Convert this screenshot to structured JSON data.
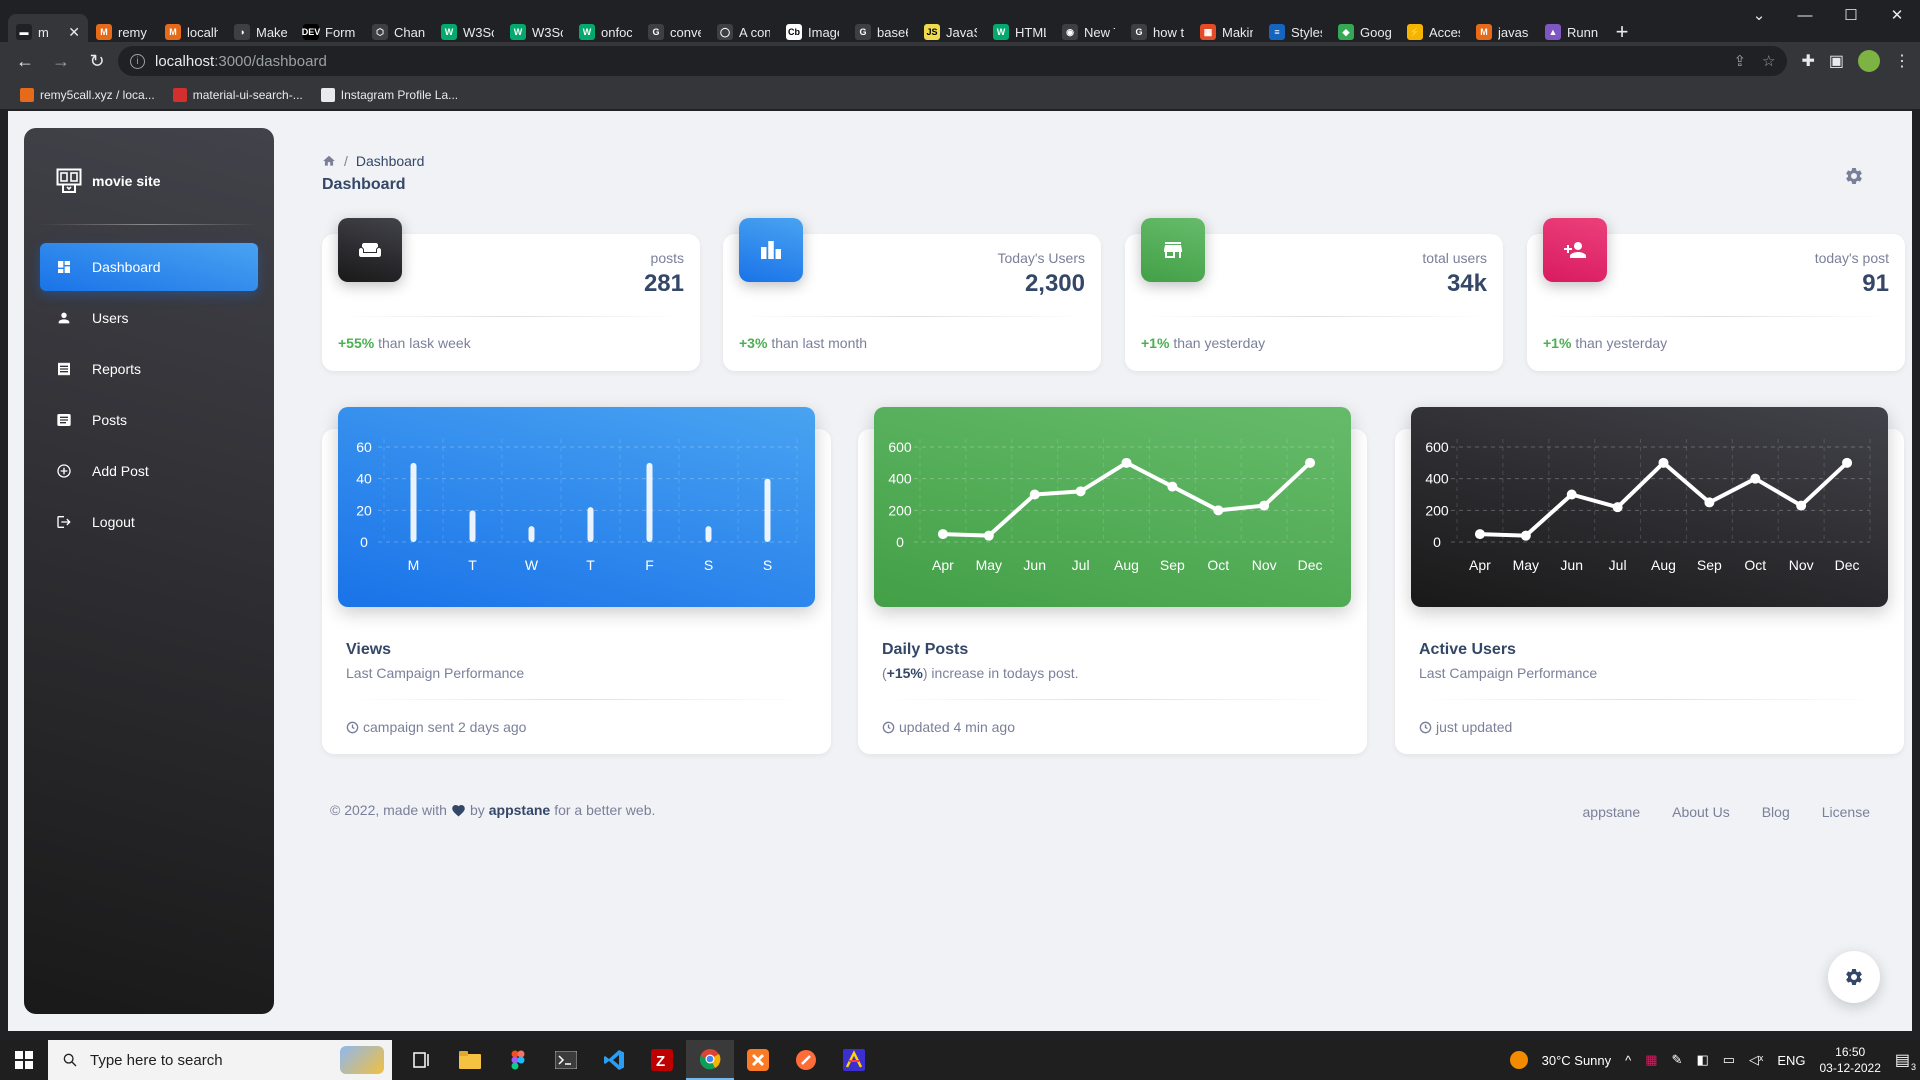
{
  "browser": {
    "tabs": [
      {
        "title": "m",
        "color": "#202124",
        "glyph": "▬"
      },
      {
        "title": "remy",
        "color": "#e56a1a",
        "glyph": "M"
      },
      {
        "title": "localh",
        "color": "#e56a1a",
        "glyph": "M"
      },
      {
        "title": "Make",
        "color": "#3c4043",
        "glyph": "◑"
      },
      {
        "title": "Form",
        "color": "#000000",
        "glyph": "DEV"
      },
      {
        "title": "Chang",
        "color": "#3c4043",
        "glyph": "⬡"
      },
      {
        "title": "W3Sc",
        "color": "#04aa6d",
        "glyph": "W"
      },
      {
        "title": "W3Sc",
        "color": "#04aa6d",
        "glyph": "W"
      },
      {
        "title": "onfoc",
        "color": "#04aa6d",
        "glyph": "W"
      },
      {
        "title": "conve",
        "color": "#3c4043",
        "glyph": "G"
      },
      {
        "title": "A con",
        "color": "#3c4043",
        "glyph": "◯"
      },
      {
        "title": "Image",
        "color": "#ffffff",
        "glyph": "Cb"
      },
      {
        "title": "base6",
        "color": "#3c4043",
        "glyph": "G"
      },
      {
        "title": "JavaS",
        "color": "#f0db4f",
        "glyph": "JS"
      },
      {
        "title": "HTML",
        "color": "#04aa6d",
        "glyph": "W"
      },
      {
        "title": "New T",
        "color": "#3c4043",
        "glyph": "◉"
      },
      {
        "title": "how t",
        "color": "#3c4043",
        "glyph": "G"
      },
      {
        "title": "Makin",
        "color": "#e34c26",
        "glyph": "▦"
      },
      {
        "title": "Styles",
        "color": "#1565c0",
        "glyph": "≡"
      },
      {
        "title": "Goog",
        "color": "#34a853",
        "glyph": "◆"
      },
      {
        "title": "Acces",
        "color": "#f4b400",
        "glyph": "⚡"
      },
      {
        "title": "javasc",
        "color": "#e56a1a",
        "glyph": "M"
      },
      {
        "title": "Runn",
        "color": "#7e57c2",
        "glyph": "▲"
      }
    ],
    "url_host": "localhost",
    "url_path": ":3000/dashboard",
    "bookmarks": [
      {
        "label": "remy5call.xyz / loca...",
        "color": "#e56a1a"
      },
      {
        "label": "material-ui-search-...",
        "color": "#d32f2f"
      },
      {
        "label": "Instagram Profile La...",
        "color": "#e8eaed"
      }
    ]
  },
  "sidebar": {
    "brand": "movie site",
    "items": [
      {
        "label": "Dashboard",
        "icon": "dashboard-icon",
        "active": true
      },
      {
        "label": "Users",
        "icon": "person-icon",
        "active": false
      },
      {
        "label": "Reports",
        "icon": "receipt-icon",
        "active": false
      },
      {
        "label": "Posts",
        "icon": "posts-icon",
        "active": false
      },
      {
        "label": "Add Post",
        "icon": "add-circle-icon",
        "active": false
      },
      {
        "label": "Logout",
        "icon": "logout-icon",
        "active": false
      }
    ]
  },
  "header": {
    "breadcrumb_current": "Dashboard",
    "title": "Dashboard"
  },
  "stats": [
    {
      "label": "posts",
      "value": "281",
      "pct": "+55%",
      "foot": "than lask week",
      "icon": "weekend-icon",
      "gradient": [
        "#42424a",
        "#191919"
      ]
    },
    {
      "label": "Today's Users",
      "value": "2,300",
      "pct": "+3%",
      "foot": "than last month",
      "icon": "leaderboard-icon",
      "gradient": [
        "#49a3f1",
        "#1a73e8"
      ]
    },
    {
      "label": "total users",
      "value": "34k",
      "pct": "+1%",
      "foot": "than yesterday",
      "icon": "store-icon",
      "gradient": [
        "#66bb6a",
        "#43a047"
      ]
    },
    {
      "label": "today's post",
      "value": "91",
      "pct": "+1%",
      "foot": "than yesterday",
      "icon": "person-add-icon",
      "gradient": [
        "#ec407a",
        "#d81b60"
      ]
    }
  ],
  "charts": [
    {
      "title": "Views",
      "subtitle_pre": "",
      "subtitle_bold": "",
      "subtitle_post": "Last Campaign Performance",
      "foot": "campaign sent 2 days ago",
      "gradient": [
        "#49a3f1",
        "#1a73e8"
      ]
    },
    {
      "title": "Daily Posts",
      "subtitle_pre": "(",
      "subtitle_bold": "+15%",
      "subtitle_post": ") increase in todays post.",
      "foot": "updated 4 min ago",
      "gradient": [
        "#66bb6a",
        "#43a047"
      ]
    },
    {
      "title": "Active Users",
      "subtitle_pre": "",
      "subtitle_bold": "",
      "subtitle_post": "Last Campaign Performance",
      "foot": "just updated",
      "gradient": [
        "#42424a",
        "#191919"
      ]
    }
  ],
  "chart_data": [
    {
      "type": "bar",
      "categories": [
        "M",
        "T",
        "W",
        "T",
        "F",
        "S",
        "S"
      ],
      "values": [
        50,
        20,
        10,
        22,
        50,
        10,
        40
      ],
      "yticks": [
        0,
        20,
        40,
        60
      ],
      "ylim": [
        0,
        60
      ],
      "grid": true
    },
    {
      "type": "line",
      "categories": [
        "Apr",
        "May",
        "Jun",
        "Jul",
        "Aug",
        "Sep",
        "Oct",
        "Nov",
        "Dec"
      ],
      "values": [
        50,
        40,
        300,
        320,
        500,
        350,
        200,
        230,
        500
      ],
      "yticks": [
        0,
        200,
        400,
        600
      ],
      "ylim": [
        0,
        600
      ],
      "grid": true
    },
    {
      "type": "line",
      "categories": [
        "Apr",
        "May",
        "Jun",
        "Jul",
        "Aug",
        "Sep",
        "Oct",
        "Nov",
        "Dec"
      ],
      "values": [
        50,
        40,
        300,
        220,
        500,
        250,
        400,
        230,
        500
      ],
      "yticks": [
        0,
        200,
        400,
        600
      ],
      "ylim": [
        0,
        600
      ],
      "grid": true
    }
  ],
  "footer": {
    "pre": "© 2022, made with",
    "by": "by",
    "author": "appstane",
    "post": "for a better web.",
    "links": [
      "appstane",
      "About Us",
      "Blog",
      "License"
    ]
  },
  "taskbar": {
    "search_placeholder": "Type here to search",
    "weather": "30°C  Sunny",
    "lang": "ENG",
    "time": "16:50",
    "date": "03-12-2022",
    "notif_count": "3"
  }
}
